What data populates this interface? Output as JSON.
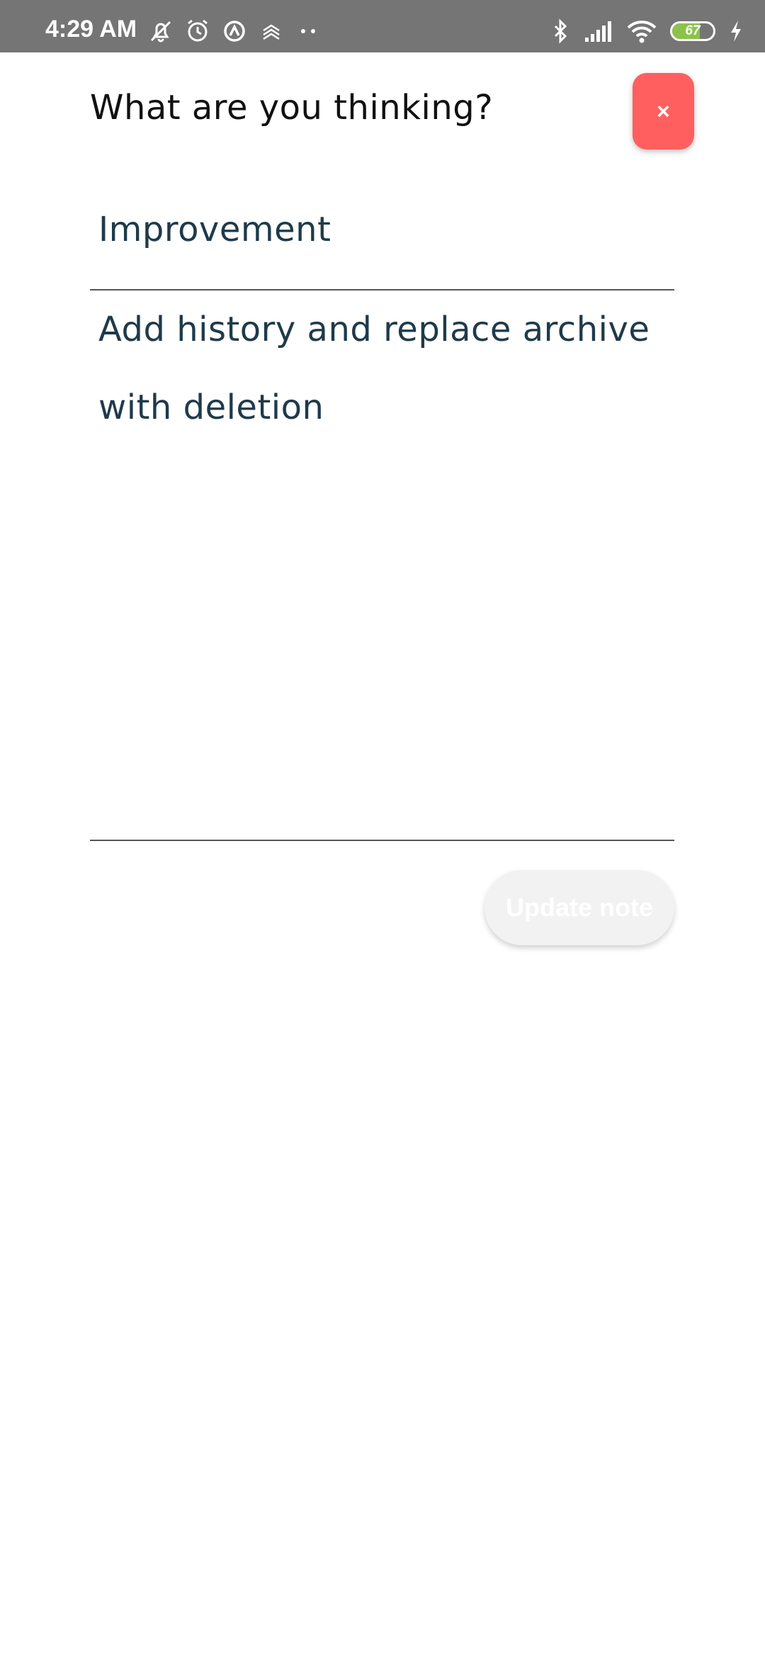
{
  "status_bar": {
    "time": "4:29 AM",
    "battery_level": "67",
    "battery_fraction": 0.67,
    "left_icons": [
      "muted-bell-icon",
      "alarm-icon",
      "sync-icon",
      "data-icon",
      "more-dots-icon"
    ],
    "right_icons": [
      "bluetooth-icon",
      "signal-icon",
      "wifi-icon",
      "battery-icon",
      "charging-icon"
    ]
  },
  "dialog": {
    "heading": "What are you thinking?",
    "close_label": "×"
  },
  "form": {
    "title_value": "Improvement",
    "body_value": "Add history and replace archive with deletion",
    "submit_label": "Update note"
  },
  "colors": {
    "close_button": "#ff5f5f",
    "status_bar": "#757575",
    "text": "#1f3a4a",
    "submit_disabled": "#f2f2f2"
  }
}
